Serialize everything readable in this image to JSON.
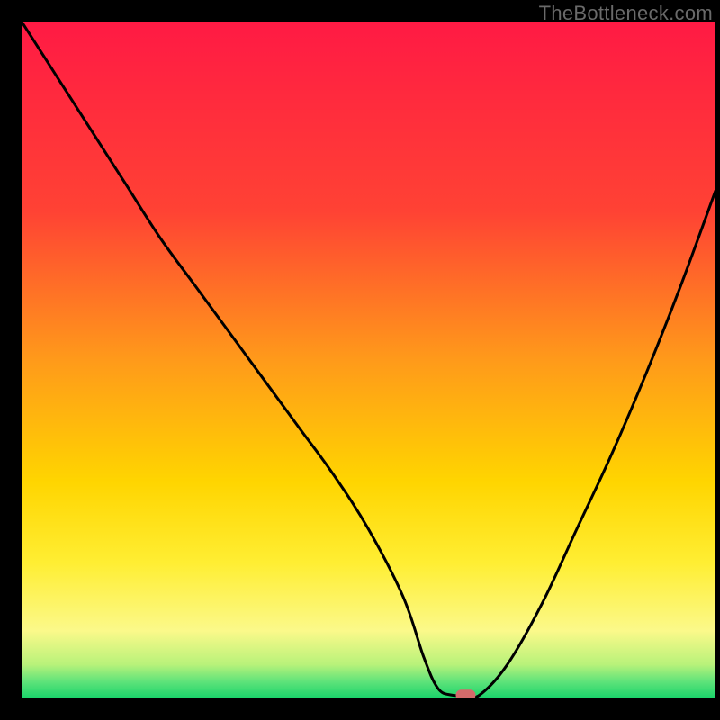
{
  "watermark": "TheBottleneck.com",
  "chart_data": {
    "type": "line",
    "title": "",
    "xlabel": "",
    "ylabel": "",
    "xlim": [
      0,
      100
    ],
    "ylim": [
      0,
      100
    ],
    "x": [
      0,
      5,
      10,
      15,
      20,
      25,
      30,
      35,
      40,
      45,
      50,
      55,
      58,
      60,
      62,
      64,
      66,
      70,
      75,
      80,
      85,
      90,
      95,
      100
    ],
    "values": [
      100,
      92,
      84,
      76,
      68,
      61,
      54,
      47,
      40,
      33,
      25,
      15,
      6,
      1.5,
      0.5,
      0.5,
      0.5,
      5,
      14,
      25,
      36,
      48,
      61,
      75
    ],
    "marker": {
      "x": 64,
      "y": 0.5
    },
    "gradient_stops": [
      {
        "offset": 0.0,
        "color": "#ff1a44"
      },
      {
        "offset": 0.28,
        "color": "#ff4234"
      },
      {
        "offset": 0.5,
        "color": "#ff9a1a"
      },
      {
        "offset": 0.68,
        "color": "#ffd500"
      },
      {
        "offset": 0.8,
        "color": "#ffee33"
      },
      {
        "offset": 0.9,
        "color": "#fbf98a"
      },
      {
        "offset": 0.95,
        "color": "#b8f27a"
      },
      {
        "offset": 0.975,
        "color": "#5fe37a"
      },
      {
        "offset": 1.0,
        "color": "#18d36a"
      }
    ]
  }
}
